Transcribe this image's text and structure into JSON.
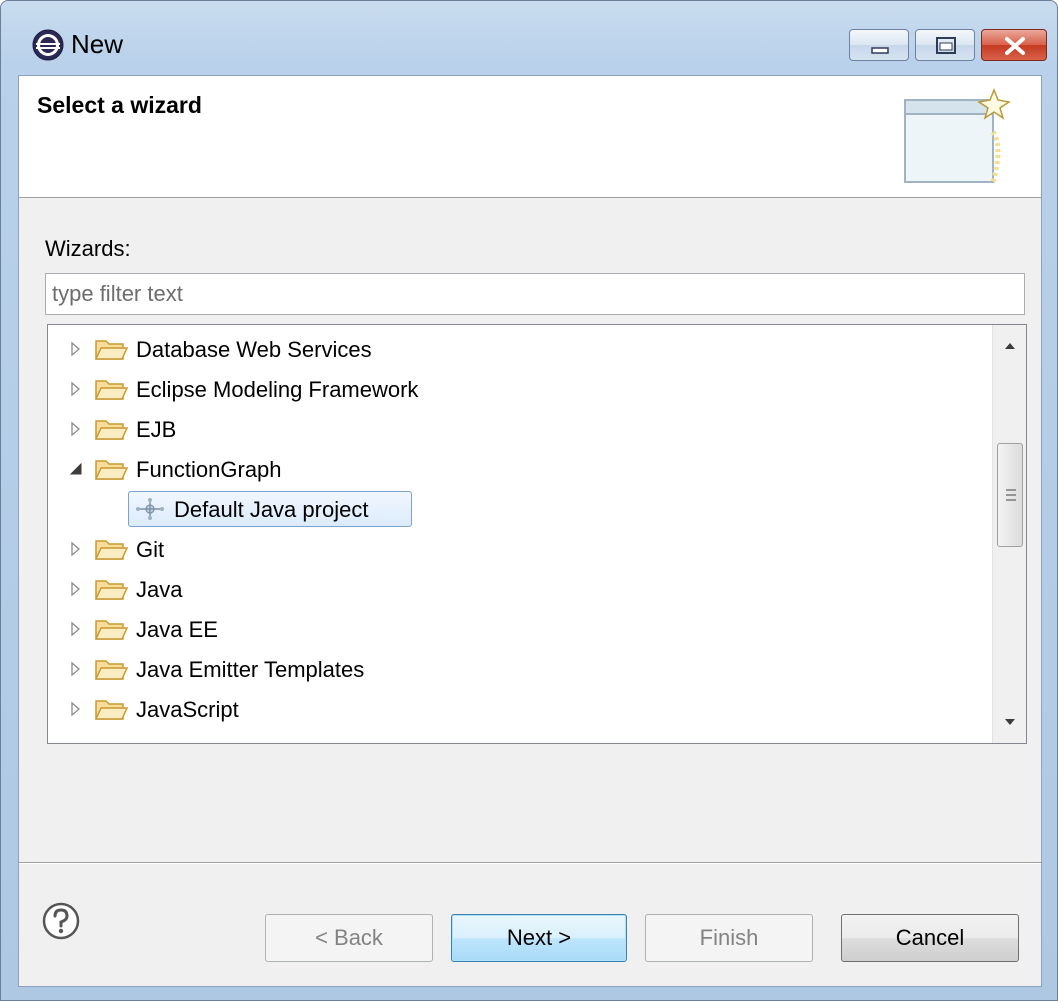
{
  "window": {
    "title": "New",
    "icons": {
      "app": "eclipse-icon",
      "minimize": "minimize-icon",
      "maximize": "maximize-icon",
      "close": "close-icon"
    }
  },
  "header": {
    "title": "Select a wizard",
    "art_icon": "new-wizard-window-icon"
  },
  "wizards_label": "Wizards:",
  "filter": {
    "placeholder": "type filter text",
    "value": ""
  },
  "tree": {
    "items": [
      {
        "label": "Database Web Services",
        "expanded": false,
        "level": 0,
        "icon": "folder-icon"
      },
      {
        "label": "Eclipse Modeling Framework",
        "expanded": false,
        "level": 0,
        "icon": "folder-icon"
      },
      {
        "label": "EJB",
        "expanded": false,
        "level": 0,
        "icon": "folder-icon"
      },
      {
        "label": "FunctionGraph",
        "expanded": true,
        "level": 0,
        "icon": "folder-icon"
      },
      {
        "label": "Default Java project",
        "level": 1,
        "selected": true,
        "icon": "java-project-icon"
      },
      {
        "label": "Git",
        "expanded": false,
        "level": 0,
        "icon": "folder-icon"
      },
      {
        "label": "Java",
        "expanded": false,
        "level": 0,
        "icon": "folder-icon"
      },
      {
        "label": "Java EE",
        "expanded": false,
        "level": 0,
        "icon": "folder-icon"
      },
      {
        "label": "Java Emitter Templates",
        "expanded": false,
        "level": 0,
        "icon": "folder-icon"
      },
      {
        "label": "JavaScript",
        "expanded": false,
        "level": 0,
        "icon": "folder-icon"
      }
    ]
  },
  "buttons": {
    "back": "< Back",
    "next": "Next >",
    "finish": "Finish",
    "cancel": "Cancel"
  },
  "help_icon": "help-icon",
  "colors": {
    "selection_border": "#7da2ce",
    "folder": "#e8c46a",
    "default_button": "#3c7fb1"
  }
}
